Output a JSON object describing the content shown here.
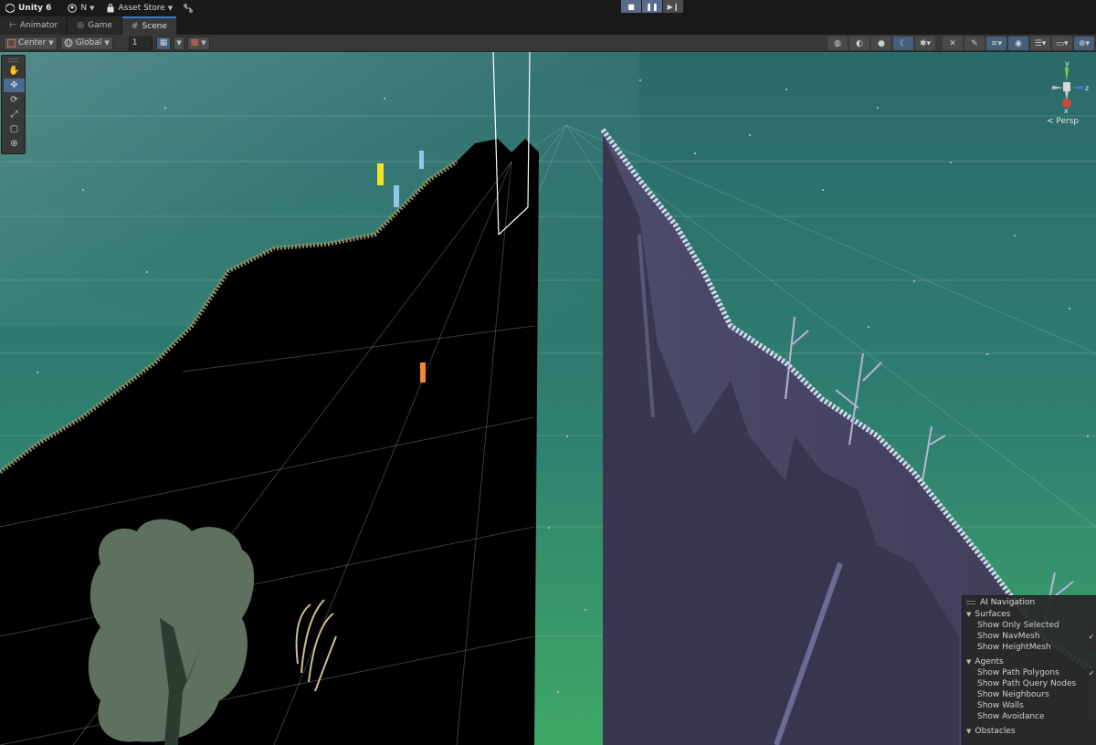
{
  "topbar": {
    "app_title": "Unity 6",
    "account_label": "N",
    "asset_store_label": "Asset Store",
    "play_buttons": [
      "■",
      "❚❚",
      "▶❙"
    ]
  },
  "tabs": [
    {
      "label": "Animator",
      "glyph": "⊢"
    },
    {
      "label": "Game",
      "glyph": "◎"
    },
    {
      "label": "Scene",
      "glyph": "#"
    }
  ],
  "scene_toolbar": {
    "pivot_label": "Center",
    "space_label": "Global",
    "grid_snap_value": "1"
  },
  "gizmo": {
    "y_label": "y",
    "x_label": "x",
    "z_label": "z",
    "projection_label": "< Persp"
  },
  "ai_navigation": {
    "title": "AI Navigation",
    "surfaces": {
      "label": "Surfaces",
      "options": [
        {
          "label": "Show Only Selected",
          "checked": false
        },
        {
          "label": "Show NavMesh",
          "checked": true
        },
        {
          "label": "Show HeightMesh",
          "checked": false
        }
      ]
    },
    "agents": {
      "label": "Agents",
      "options": [
        {
          "label": "Show Path Polygons",
          "checked": true
        },
        {
          "label": "Show Path Query Nodes",
          "checked": false
        },
        {
          "label": "Show Neighbours",
          "checked": false
        },
        {
          "label": "Show Walls",
          "checked": false
        },
        {
          "label": "Show Avoidance",
          "checked": false
        }
      ]
    },
    "obstacles": {
      "label": "Obstacles"
    }
  },
  "colors": {
    "sky_top": "#2c6e6a",
    "sky_bottom": "#3a9e66",
    "left_wall": "#000000",
    "right_wall": "#4a4866",
    "accent": "#3a79bb"
  }
}
